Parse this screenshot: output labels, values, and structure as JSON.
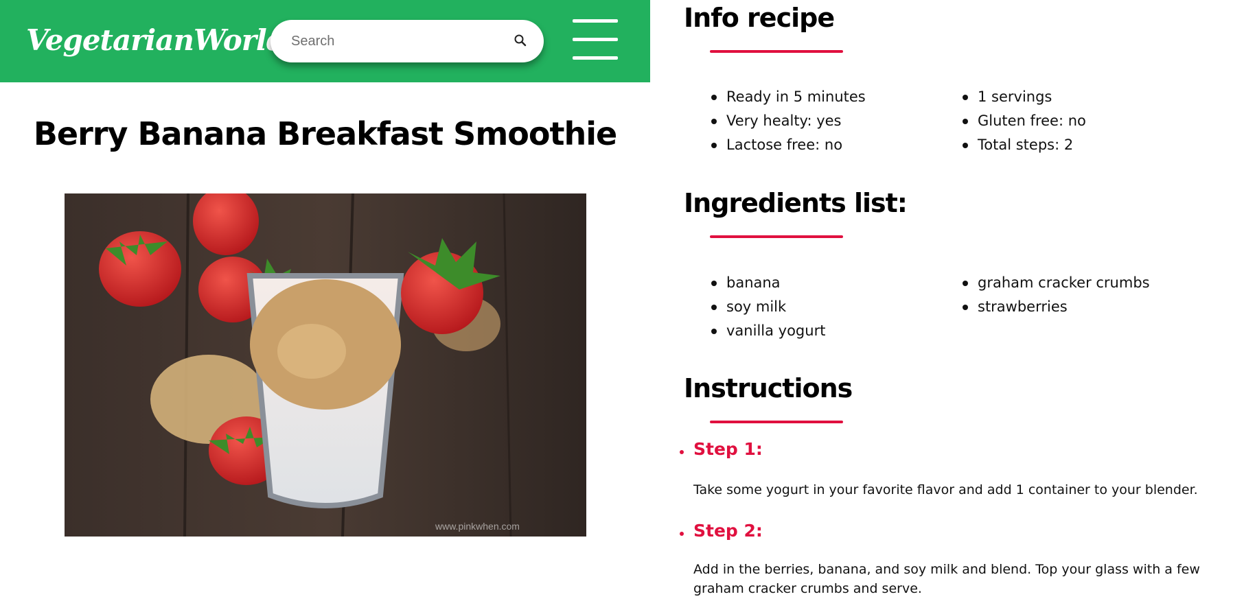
{
  "header": {
    "logo": "VegetarianWorld",
    "search_placeholder": "Search"
  },
  "recipe": {
    "title": "Berry Banana Breakfast Smoothie",
    "image_watermark": "www.pinkwhen.com"
  },
  "info": {
    "heading": "Info recipe",
    "left": [
      "Ready in 5 minutes",
      "Very healty: yes",
      "Lactose free: no"
    ],
    "right": [
      "1 servings",
      "Gluten free: no",
      "Total steps: 2"
    ]
  },
  "ingredients": {
    "heading": "Ingredients list:",
    "left": [
      "banana",
      "soy milk",
      "vanilla yogurt"
    ],
    "right": [
      "graham cracker crumbs",
      "strawberries"
    ]
  },
  "instructions": {
    "heading": "Instructions",
    "steps": [
      {
        "label": "Step 1:",
        "text": "Take some yogurt in your favorite flavor and add 1 container to your blender."
      },
      {
        "label": "Step 2:",
        "text": "Add in the berries, banana, and soy milk and blend. Top your glass with a few graham cracker crumbs and serve."
      }
    ]
  },
  "colors": {
    "header_bg": "#22b15e",
    "accent": "#e0103f"
  }
}
